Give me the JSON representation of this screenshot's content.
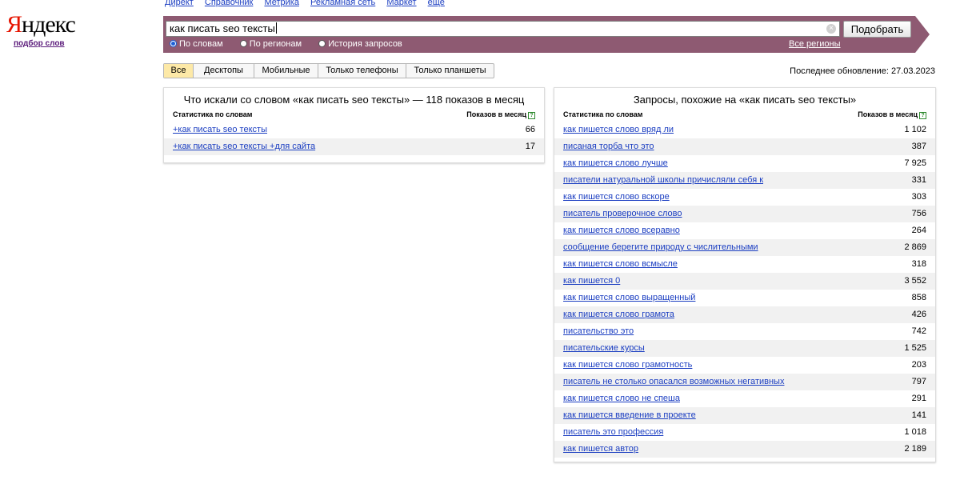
{
  "logo": {
    "text_first": "Я",
    "text_rest": "ндекс",
    "subtitle": "подбор слов"
  },
  "top_links": [
    "Директ",
    "Справочник",
    "Метрика",
    "Рекламная сеть",
    "Маркет",
    "ещё"
  ],
  "search": {
    "value": "как писать seo тексты",
    "submit_label": "Подобрать",
    "clear_icon": "×",
    "radios": [
      {
        "label": "По словам",
        "checked": true
      },
      {
        "label": "По регионам",
        "checked": false
      },
      {
        "label": "История запросов",
        "checked": false
      }
    ],
    "regions_link": "Все регионы"
  },
  "tabs": [
    {
      "label": "Все",
      "active": true
    },
    {
      "label": "Десктопы",
      "active": false
    },
    {
      "label": "Мобильные",
      "active": false
    },
    {
      "label": "Только телефоны",
      "active": false
    },
    {
      "label": "Только планшеты",
      "active": false
    }
  ],
  "last_update": "Последнее обновление: 27.03.2023",
  "left_panel": {
    "title": "Что искали со словом «как писать seo тексты» — 118 показов в месяц",
    "col_phrase": "Статистика по словам",
    "col_count": "Показов в месяц",
    "help_icon": "?",
    "rows": [
      {
        "phrase": "+как писать seo тексты",
        "count": "66"
      },
      {
        "phrase": "+как писать seo тексты +для сайта",
        "count": "17"
      }
    ]
  },
  "right_panel": {
    "title": "Запросы, похожие на «как писать seo тексты»",
    "col_phrase": "Статистика по словам",
    "col_count": "Показов в месяц",
    "help_icon": "?",
    "rows": [
      {
        "phrase": "как пишется слово вряд ли",
        "count": "1 102"
      },
      {
        "phrase": "писаная торба что это",
        "count": "387"
      },
      {
        "phrase": "как пишется слово лучше",
        "count": "7 925"
      },
      {
        "phrase": "писатели натуральной школы причисляли себя к",
        "count": "331"
      },
      {
        "phrase": "как пишется слово вскоре",
        "count": "303"
      },
      {
        "phrase": "писатель проверочное слово",
        "count": "756"
      },
      {
        "phrase": "как пишется слово всеравно",
        "count": "264"
      },
      {
        "phrase": "сообщение берегите природу с числительными",
        "count": "2 869"
      },
      {
        "phrase": "как пишется слово всмысле",
        "count": "318"
      },
      {
        "phrase": "как пишется 0",
        "count": "3 552"
      },
      {
        "phrase": "как пишется слово выращенный",
        "count": "858"
      },
      {
        "phrase": "как пишется слово грамота",
        "count": "426"
      },
      {
        "phrase": "писательство это",
        "count": "742"
      },
      {
        "phrase": "писательские курсы",
        "count": "1 525"
      },
      {
        "phrase": "как пишется слово грамотность",
        "count": "203"
      },
      {
        "phrase": "писатель не столько опасался возможных негативных",
        "count": "797"
      },
      {
        "phrase": "как пишется слово не спеша",
        "count": "291"
      },
      {
        "phrase": "как пишется введение в проекте",
        "count": "141"
      },
      {
        "phrase": "писатель это профессия",
        "count": "1 018"
      },
      {
        "phrase": "как пишется автор",
        "count": "2 189"
      }
    ]
  },
  "colors": {
    "band": "#8e5a72",
    "link": "#1a3dc1",
    "logo_accent": "#e61400",
    "tab_active": "#fde9a7"
  }
}
